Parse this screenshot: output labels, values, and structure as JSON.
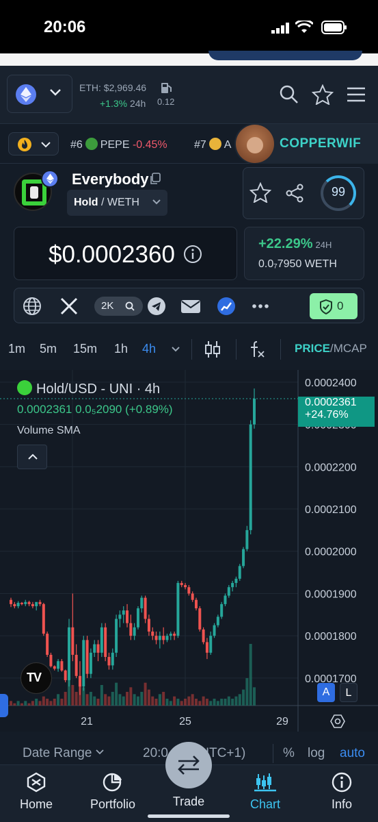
{
  "status_bar": {
    "time": "20:06"
  },
  "header": {
    "eth_price": "ETH: $2,969.46",
    "eth_change": "+1.3%",
    "eth_change_tf": "24h",
    "gas_value": "0.12"
  },
  "ticker": {
    "items": [
      {
        "rank": "#6",
        "symbol": "PEPE",
        "change": "-0.45%"
      },
      {
        "rank": "#7",
        "symbol": "A",
        "change": ""
      }
    ],
    "featured": "COPPERWIF"
  },
  "token": {
    "name": "Everybody",
    "pair_base": "Hold",
    "pair_quote": " / WETH",
    "price": "$0.0002360",
    "change_24h": "+22.29%",
    "change_tf": "24H",
    "price_weth": "0.0₇7950 WETH",
    "score": "99"
  },
  "social": {
    "twitter_followers": "2K",
    "audit_count": "0"
  },
  "timeframes": {
    "items": [
      "1m",
      "5m",
      "15m",
      "1h",
      "4h"
    ],
    "active": "4h",
    "mode_price": "PRICE",
    "mode_sep": "/",
    "mode_mcap": "MCAP"
  },
  "chart_legend": {
    "title": "Hold/USD - UNI · 4h",
    "values": "0.0002361  0.0₅2090 (+0.89%)",
    "volume": "Volume SMA",
    "last_price": "0.0002361",
    "last_change": "+24.76%",
    "scale_a": "A",
    "scale_l": "L",
    "tv_logo": "TV"
  },
  "chart_data": {
    "type": "candlestick",
    "title": "Hold/USD - UNI · 4h",
    "y_ticks": [
      "0.0002400",
      "0.0002300",
      "0.0002200",
      "0.0002100",
      "0.0002000",
      "0.0001900",
      "0.0001800",
      "0.0001700"
    ],
    "x_ticks": [
      "21",
      "25",
      "29"
    ],
    "ylim": [
      0.0001635,
      0.0002429
    ],
    "last_price": 0.0002361,
    "up_color": "#26a69a",
    "down_color": "#ef5350",
    "candles": [
      [
        0.0001885,
        0.000189,
        0.0001868,
        0.0001875
      ],
      [
        0.0001875,
        0.000188,
        0.0001865,
        0.000187
      ],
      [
        0.000187,
        0.0001882,
        0.0001865,
        0.0001878
      ],
      [
        0.0001878,
        0.000188,
        0.0001872,
        0.0001875
      ],
      [
        0.0001875,
        0.0001885,
        0.000187,
        0.000188
      ],
      [
        0.000188,
        0.0001883,
        0.000187,
        0.0001875
      ],
      [
        0.0001875,
        0.000188,
        0.0001865,
        0.000187
      ],
      [
        0.000187,
        0.0001875,
        0.000186,
        0.000188
      ],
      [
        0.000188,
        0.0001885,
        0.000187,
        0.0001875
      ],
      [
        0.0001875,
        0.0001878,
        0.00018,
        0.0001805
      ],
      [
        0.0001805,
        0.000181,
        0.000175,
        0.0001755
      ],
      [
        0.0001755,
        0.000176,
        0.0001725,
        0.0001728
      ],
      [
        0.0001728,
        0.000173,
        0.0001718,
        0.0001722
      ],
      [
        0.0001722,
        0.0001745,
        0.0001715,
        0.000174
      ],
      [
        0.000174,
        0.0001745,
        0.0001715,
        0.0001718
      ],
      [
        0.0001718,
        0.000172,
        0.000169,
        0.0001695
      ],
      [
        0.0001695,
        0.000184,
        0.000168,
        0.000182
      ],
      [
        0.000182,
        0.00019,
        0.000174,
        0.0001755
      ],
      [
        0.0001755,
        0.000178,
        0.00017,
        0.0001705
      ],
      [
        0.0001705,
        0.000174,
        0.000166,
        0.000168
      ],
      [
        0.000168,
        0.00018,
        0.000167,
        0.000179
      ],
      [
        0.000179,
        0.00018,
        0.00017,
        0.000171
      ],
      [
        0.000171,
        0.000177,
        0.00017,
        0.000176
      ],
      [
        0.000176,
        0.000179,
        0.000175,
        0.000178
      ],
      [
        0.000178,
        0.000179,
        0.000174,
        0.000176
      ],
      [
        0.000176,
        0.000183,
        0.000175,
        0.000182
      ],
      [
        0.000182,
        0.000183,
        0.000174,
        0.000175
      ],
      [
        0.000175,
        0.000176,
        0.000172,
        0.000173
      ],
      [
        0.000173,
        0.000177,
        0.000172,
        0.000176
      ],
      [
        0.000176,
        0.000185,
        0.000175,
        0.000184
      ],
      [
        0.000184,
        0.000186,
        0.000182,
        0.000185
      ],
      [
        0.000185,
        0.000187,
        0.000183,
        0.000186
      ],
      [
        0.000186,
        0.0001875,
        0.000182,
        0.000183
      ],
      [
        0.000183,
        0.000185,
        0.000179,
        0.00018
      ],
      [
        0.00018,
        0.000183,
        0.000179,
        0.000182
      ],
      [
        0.000182,
        0.000187,
        0.0001815,
        0.0001865
      ],
      [
        0.0001865,
        0.0001895,
        0.0001855,
        0.000189
      ],
      [
        0.000189,
        0.0001895,
        0.000183,
        0.000184
      ],
      [
        0.000184,
        0.000185,
        0.00018,
        0.000181
      ],
      [
        0.000181,
        0.000182,
        0.000179,
        0.00018
      ],
      [
        0.00018,
        0.000181,
        0.000178,
        0.000179
      ],
      [
        0.000179,
        0.000181,
        0.000177,
        0.00018
      ],
      [
        0.00018,
        0.000182,
        0.000178,
        0.000179
      ],
      [
        0.000179,
        0.0001805,
        0.0001785,
        0.00018
      ],
      [
        0.00018,
        0.000181,
        0.000179,
        0.0001805
      ],
      [
        0.0001805,
        0.000181,
        0.000179,
        0.00018
      ],
      [
        0.00018,
        0.000193,
        0.0001795,
        0.0001925
      ],
      [
        0.0001925,
        0.000193,
        0.0001915,
        0.000192
      ],
      [
        0.000192,
        0.0001925,
        0.000191,
        0.0001915
      ],
      [
        0.0001915,
        0.000192,
        0.0001895,
        0.00019
      ],
      [
        0.00019,
        0.0001905,
        0.000188,
        0.0001885
      ],
      [
        0.0001885,
        0.000189,
        0.000186,
        0.0001865
      ],
      [
        0.0001865,
        0.000187,
        0.000181,
        0.0001815
      ],
      [
        0.0001815,
        0.000182,
        0.000178,
        0.0001785
      ],
      [
        0.0001785,
        0.0001795,
        0.0001745,
        0.000176
      ],
      [
        0.000176,
        0.000181,
        0.0001755,
        0.00018
      ],
      [
        0.00018,
        0.000183,
        0.0001795,
        0.0001825
      ],
      [
        0.0001825,
        0.000185,
        0.000182,
        0.0001845
      ],
      [
        0.0001845,
        0.000188,
        0.000184,
        0.0001875
      ],
      [
        0.0001875,
        0.00019,
        0.000187,
        0.0001895
      ],
      [
        0.0001895,
        0.000192,
        0.000189,
        0.0001915
      ],
      [
        0.0001915,
        0.000193,
        0.0001905,
        0.0001925
      ],
      [
        0.0001925,
        0.000194,
        0.0001915,
        0.0001935
      ],
      [
        0.0001935,
        0.000197,
        0.000193,
        0.0001965
      ],
      [
        0.0001965,
        0.000201,
        0.000196,
        0.0002005
      ],
      [
        0.0002005,
        0.000206,
        0.0002,
        0.000205
      ],
      [
        0.000205,
        0.000231,
        0.000204,
        0.00023
      ],
      [
        0.00023,
        0.0002385,
        0.000229,
        0.0002361
      ]
    ],
    "volumes": [
      2,
      1,
      2,
      1,
      2,
      1,
      2,
      3,
      2,
      4,
      3,
      2,
      3,
      5,
      3,
      6,
      14,
      9,
      6,
      12,
      8,
      5,
      6,
      4,
      3,
      9,
      5,
      4,
      6,
      10,
      5,
      4,
      6,
      8,
      5,
      4,
      6,
      10,
      7,
      4,
      3,
      5,
      6,
      3,
      2,
      4,
      3,
      2,
      3,
      4,
      5,
      3,
      2,
      4,
      3,
      2,
      3,
      2,
      3,
      3,
      4,
      3,
      4,
      5,
      7,
      12,
      27,
      8
    ]
  },
  "axis_extra": {
    "time_label": "20:0",
    "timezone": "(UTC+1)"
  },
  "date_row": {
    "date_range": "Date Range",
    "time": "20:0",
    "timezone": "(UTC+1)",
    "percent": "%",
    "log": "log",
    "auto": "auto"
  },
  "bottom_nav": {
    "home": "Home",
    "portfolio": "Portfolio",
    "trade": "Trade",
    "chart": "Chart",
    "info": "Info"
  }
}
